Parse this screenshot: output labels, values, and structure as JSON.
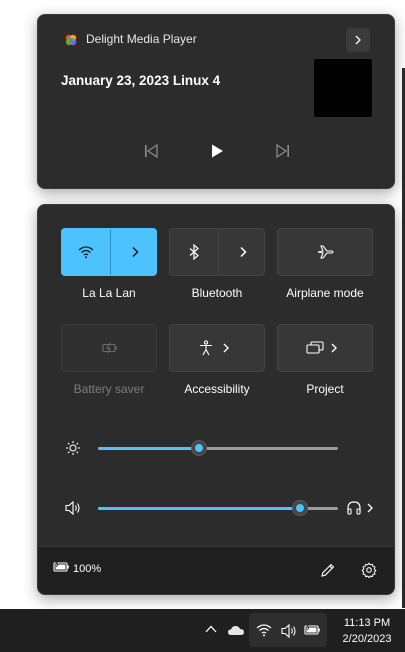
{
  "media": {
    "app_name": "Delight Media Player",
    "track_title": "January 23, 2023 Linux 4",
    "album_art_color": "#000000"
  },
  "quick_settings": {
    "accent_color": "#4cc2ff",
    "tiles": [
      {
        "id": "wifi",
        "label": "La La Lan",
        "active": true,
        "expandable": true
      },
      {
        "id": "bluetooth",
        "label": "Bluetooth",
        "active": false,
        "expandable": true
      },
      {
        "id": "airplane",
        "label": "Airplane mode",
        "active": false,
        "expandable": false
      },
      {
        "id": "battery-saver",
        "label": "Battery saver",
        "active": false,
        "disabled": true
      },
      {
        "id": "accessibility",
        "label": "Accessibility",
        "active": false,
        "expandable": true
      },
      {
        "id": "project",
        "label": "Project",
        "active": false,
        "expandable": true
      }
    ],
    "brightness_level": 0.42,
    "volume_level": 0.84,
    "battery_percent": "100%"
  },
  "taskbar": {
    "time": "11:13 PM",
    "date": "2/20/2023"
  }
}
